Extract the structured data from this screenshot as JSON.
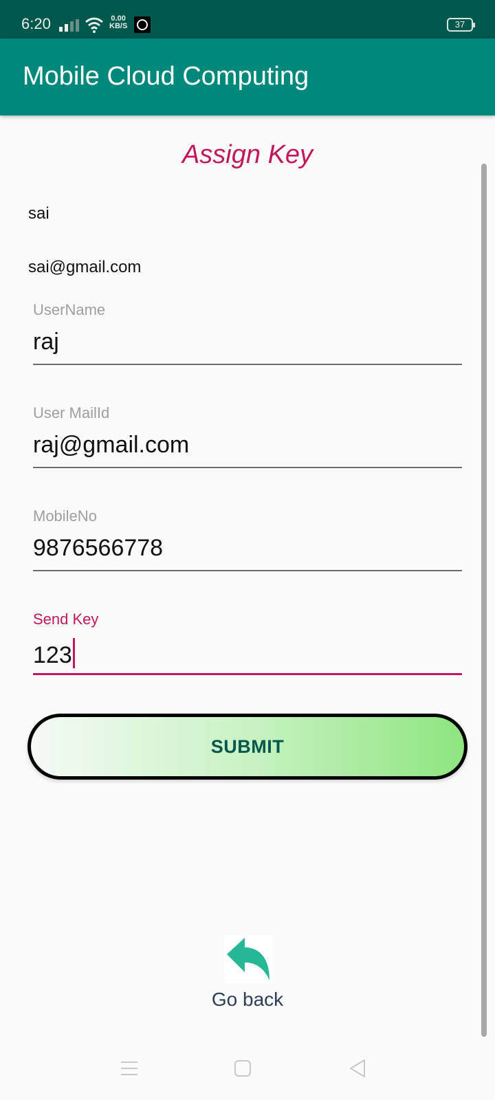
{
  "status_bar": {
    "time": "6:20",
    "net_speed_value": "0.00",
    "net_speed_unit": "KB/S",
    "battery": "37"
  },
  "app_bar": {
    "title": "Mobile Cloud Computing"
  },
  "page": {
    "heading": "Assign Key",
    "owner_name": "sai",
    "owner_email": "sai@gmail.com"
  },
  "form": {
    "username": {
      "label": "UserName",
      "value": "raj"
    },
    "mail": {
      "label": "User MailId",
      "value": "raj@gmail.com"
    },
    "mobile": {
      "label": "MobileNo",
      "value": "9876566778"
    },
    "key": {
      "label": "Send Key",
      "value": "123"
    }
  },
  "submit_label": "SUBMIT",
  "go_back_label": "Go back",
  "colors": {
    "status_bar": "#00574b",
    "app_bar": "#00897b",
    "accent": "#c2185b",
    "back_icon": "#26b894"
  }
}
